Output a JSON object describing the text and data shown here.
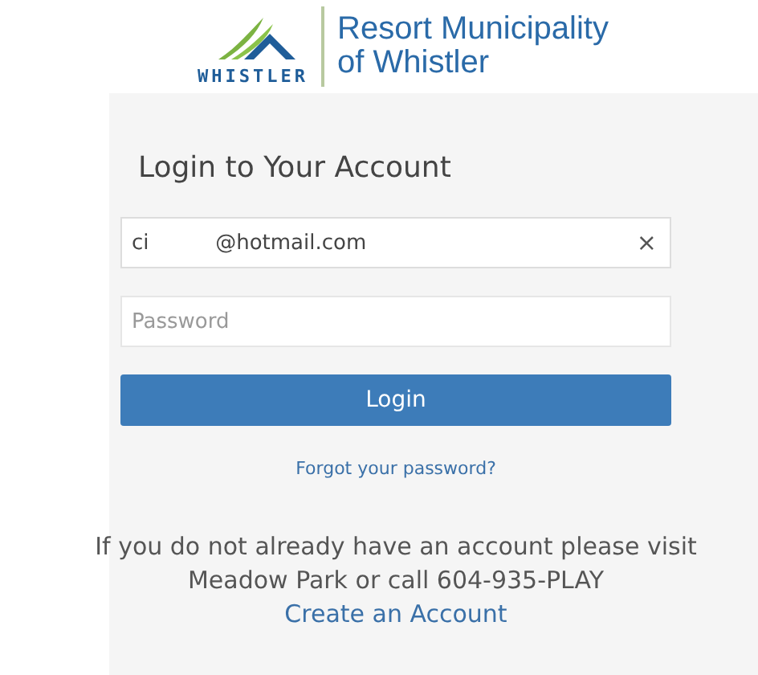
{
  "logo": {
    "wordmark": "WHISTLER",
    "title_lines": [
      "Resort Municipality",
      "of Whistler"
    ]
  },
  "heading": "Login to Your Account",
  "email": {
    "value": "ci          @hotmail.com",
    "clear": "×"
  },
  "password": {
    "placeholder": "Password"
  },
  "login_button": "Login",
  "forgot_link": "Forgot your password?",
  "signup": {
    "text": "If you do not already have an account please visit Meadow Park or call 604-935-PLAY",
    "link": "Create an Account"
  }
}
